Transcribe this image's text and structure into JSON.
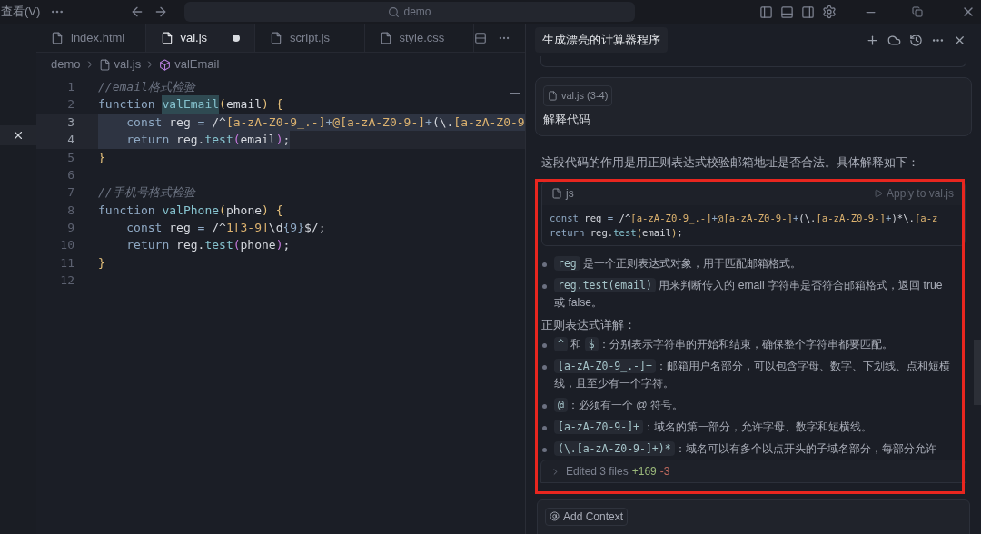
{
  "menu": {
    "label": "查看(V)"
  },
  "search": {
    "value": "demo"
  },
  "tabs": [
    {
      "label": "index.html",
      "selected": false,
      "modified": false
    },
    {
      "label": "val.js",
      "selected": true,
      "modified": true
    },
    {
      "label": "script.js",
      "selected": false,
      "modified": false
    },
    {
      "label": "style.css",
      "selected": false,
      "modified": false
    }
  ],
  "breadcrumb": [
    {
      "kind": "folder",
      "label": "demo"
    },
    {
      "kind": "file",
      "label": "val.js"
    },
    {
      "kind": "symbol",
      "label": "valEmail"
    }
  ],
  "editor": {
    "lines": [
      {
        "number": "1",
        "selected": false,
        "indented": false,
        "tokens": [
          {
            "kind": "comment",
            "text": "//email格式检验"
          }
        ]
      },
      {
        "number": "2",
        "selected": false,
        "indented": false,
        "tokens": [
          {
            "kind": "kw",
            "text": "function "
          },
          {
            "kind": "occurrence",
            "text": "valEmail"
          },
          {
            "kind": "brace",
            "text": "("
          },
          {
            "kind": "plain",
            "text": "email"
          },
          {
            "kind": "brace",
            "text": ") {"
          }
        ]
      },
      {
        "number": "3",
        "selected": true,
        "indented": true,
        "tokens": [
          {
            "kind": "kw",
            "text": "const"
          },
          {
            "kind": "plain",
            "text": " reg "
          },
          {
            "kind": "op",
            "text": "="
          },
          {
            "kind": "plain",
            "text": " /^"
          },
          {
            "kind": "regex",
            "text": "[a-zA-Z0-9_.-]"
          },
          {
            "kind": "op",
            "text": "+"
          },
          {
            "kind": "regex",
            "text": "@"
          },
          {
            "kind": "regex",
            "text": "[a-zA-Z0-9-]"
          },
          {
            "kind": "op",
            "text": "+"
          },
          {
            "kind": "plain",
            "text": "(\\."
          },
          {
            "kind": "regex",
            "text": "[a-zA-Z0-9"
          }
        ]
      },
      {
        "number": "4",
        "selected": true,
        "indented": true,
        "tokens": [
          {
            "kind": "kw",
            "text": "return"
          },
          {
            "kind": "plain",
            "text": " reg."
          },
          {
            "kind": "fn",
            "text": "test"
          },
          {
            "kind": "paren",
            "text": "("
          },
          {
            "kind": "plain",
            "text": "email"
          },
          {
            "kind": "paren",
            "text": ")"
          },
          {
            "kind": "plain",
            "text": ";"
          }
        ]
      },
      {
        "number": "5",
        "selected": false,
        "indented": false,
        "tokens": [
          {
            "kind": "brace",
            "text": "}"
          }
        ]
      },
      {
        "number": "6",
        "selected": false
      },
      {
        "number": "7",
        "selected": false,
        "indented": false,
        "tokens": [
          {
            "kind": "comment",
            "text": "//手机号格式检验"
          }
        ]
      },
      {
        "number": "8",
        "selected": false,
        "indented": false,
        "tokens": [
          {
            "kind": "kw",
            "text": "function "
          },
          {
            "kind": "fn",
            "text": "valPhone"
          },
          {
            "kind": "brace",
            "text": "("
          },
          {
            "kind": "plain",
            "text": "phone"
          },
          {
            "kind": "brace",
            "text": ") {"
          }
        ]
      },
      {
        "number": "9",
        "selected": false,
        "indented": true,
        "tokens": [
          {
            "kind": "kw",
            "text": "const"
          },
          {
            "kind": "plain",
            "text": " reg "
          },
          {
            "kind": "op",
            "text": "="
          },
          {
            "kind": "plain",
            "text": " /^"
          },
          {
            "kind": "regex",
            "text": "1[3-9]"
          },
          {
            "kind": "plain",
            "text": "\\d"
          },
          {
            "kind": "op",
            "text": "{9}"
          },
          {
            "kind": "plain",
            "text": "$/;"
          }
        ]
      },
      {
        "number": "10",
        "selected": false,
        "indented": true,
        "tokens": [
          {
            "kind": "kw",
            "text": "return"
          },
          {
            "kind": "plain",
            "text": " reg."
          },
          {
            "kind": "fn",
            "text": "test"
          },
          {
            "kind": "paren",
            "text": "("
          },
          {
            "kind": "plain",
            "text": "phone"
          },
          {
            "kind": "paren",
            "text": ")"
          },
          {
            "kind": "plain",
            "text": ";"
          }
        ]
      },
      {
        "number": "11",
        "selected": false,
        "indented": false,
        "tokens": [
          {
            "kind": "brace",
            "text": "}"
          }
        ]
      },
      {
        "number": "12",
        "selected": false
      }
    ]
  },
  "chat": {
    "title": "生成漂亮的计算器程序",
    "message": {
      "file_chip": "val.js (3-4)",
      "text": "解释代码"
    },
    "intro": "这段代码的作用是用正则表达式校验邮箱地址是否合法。具体解释如下：",
    "code_block": {
      "language": "js",
      "apply_label": "Apply to val.js",
      "lines": [
        [
          {
            "kind": "kw",
            "text": "const"
          },
          {
            "kind": "plain",
            "text": " reg "
          },
          {
            "kind": "op",
            "text": "="
          },
          {
            "kind": "plain",
            "text": " /^"
          },
          {
            "kind": "regex",
            "text": "[a-zA-Z0-9_.-]"
          },
          {
            "kind": "op",
            "text": "+"
          },
          {
            "kind": "regex",
            "text": "@[a-zA-Z0-9-]"
          },
          {
            "kind": "op",
            "text": "+"
          },
          {
            "kind": "plain",
            "text": "(\\."
          },
          {
            "kind": "regex",
            "text": "[a-zA-Z0-9-]"
          },
          {
            "kind": "op",
            "text": "+"
          },
          {
            "kind": "plain",
            "text": ")*\\."
          },
          {
            "kind": "regex",
            "text": "[a-z"
          }
        ],
        [
          {
            "kind": "kw",
            "text": "return"
          },
          {
            "kind": "plain",
            "text": " reg."
          },
          {
            "kind": "fn",
            "text": "test"
          },
          {
            "kind": "brace",
            "text": "("
          },
          {
            "kind": "plain",
            "text": "email"
          },
          {
            "kind": "brace",
            "text": ")"
          },
          {
            "kind": "plain",
            "text": ";"
          }
        ]
      ]
    },
    "bullets": [
      [
        {
          "kind": "code",
          "text": "reg"
        },
        {
          "kind": "text",
          "text": " 是一个正则表达式对象，用于匹配邮箱格式。"
        }
      ],
      [
        {
          "kind": "code",
          "text": "reg.test(email)"
        },
        {
          "kind": "text",
          "text": " 用来判断传入的 email 字符串是否符合邮箱格式，返回 true 或 false。"
        }
      ]
    ],
    "subheading": "正则表达式详解：",
    "details": [
      [
        {
          "kind": "code",
          "text": "^"
        },
        {
          "kind": "text",
          "text": " 和 "
        },
        {
          "kind": "code",
          "text": "$"
        },
        {
          "kind": "text",
          "text": "：分别表示字符串的开始和结束，确保整个字符串都要匹配。"
        }
      ],
      [
        {
          "kind": "code",
          "text": "[a-zA-Z0-9_.-]+"
        },
        {
          "kind": "text",
          "text": "：邮箱用户名部分，可以包含字母、数字、下划线、点和短横线，且至少有一个字符。"
        }
      ],
      [
        {
          "kind": "code",
          "text": "@"
        },
        {
          "kind": "text",
          "text": "：必须有一个 @ 符号。"
        }
      ],
      [
        {
          "kind": "code",
          "text": "[a-zA-Z0-9-]+"
        },
        {
          "kind": "text",
          "text": "：域名的第一部分，允许字母、数字和短横线。"
        }
      ],
      [
        {
          "kind": "code",
          "text": "(\\.[a-zA-Z0-9-]+)*"
        },
        {
          "kind": "text",
          "text": "：域名可以有多个以点开头的子域名部分，每部分允许"
        }
      ]
    ],
    "edited": {
      "label": "Edited 3 files",
      "added": "+169",
      "removed": "-3"
    },
    "input": {
      "add_context": "Add Context"
    }
  }
}
